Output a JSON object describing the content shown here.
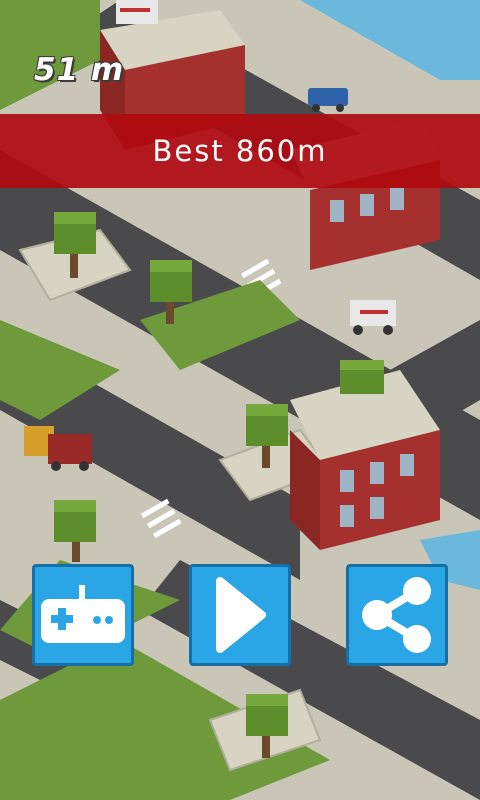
{
  "hud": {
    "distance": "51 m"
  },
  "banner": {
    "best": "Best 860m"
  },
  "buttons": {
    "games_icon": "gamepad-icon",
    "play_icon": "play-icon",
    "share_icon": "share-icon"
  },
  "colors": {
    "banner": "#b00a10",
    "button": "#2aa6e6",
    "grass": "#6e9a3c",
    "road": "#4a4a4c",
    "building": "#a5302e"
  }
}
